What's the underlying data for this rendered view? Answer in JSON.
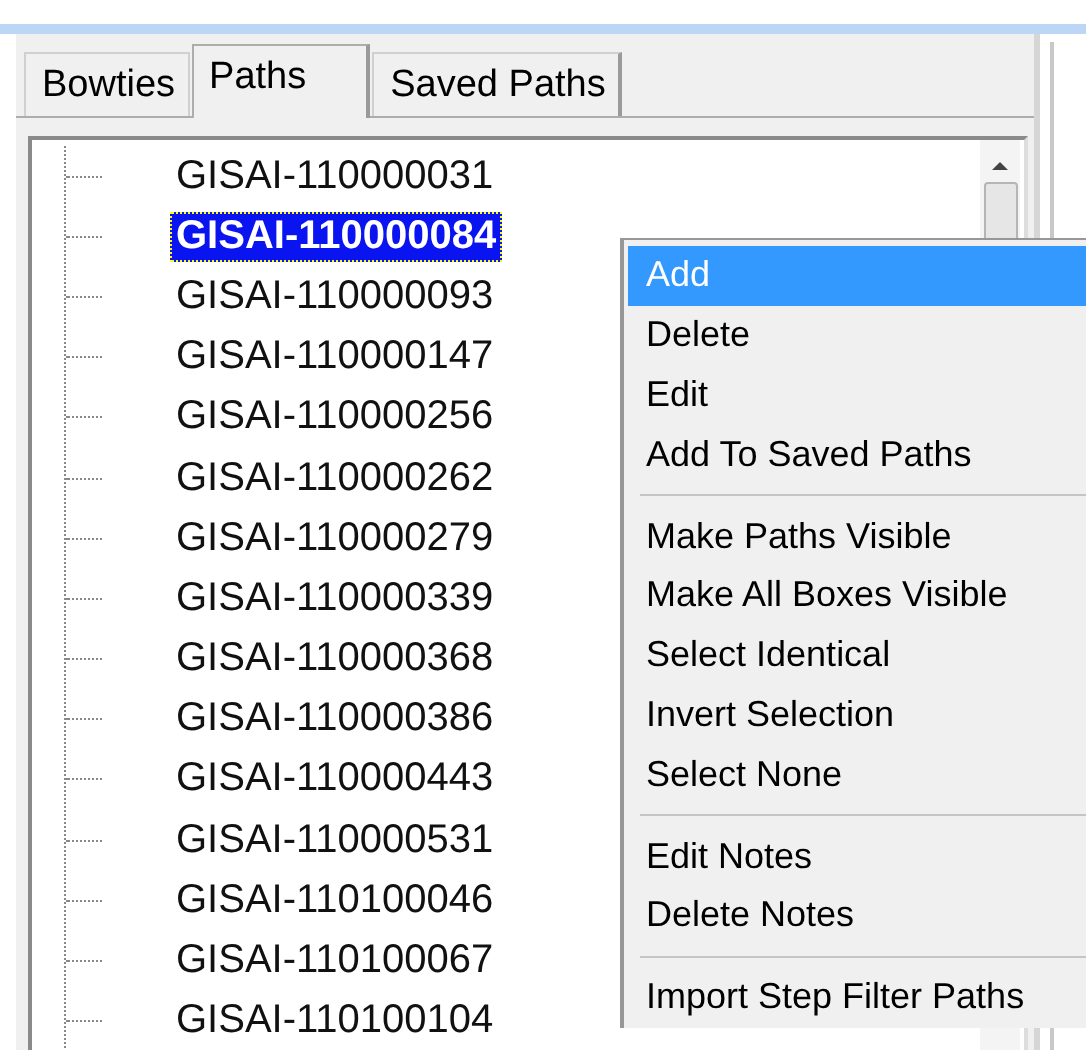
{
  "tabs": [
    {
      "label": "Bowties",
      "selected": false
    },
    {
      "label": "Paths",
      "selected": true
    },
    {
      "label": "Saved Paths",
      "selected": false
    }
  ],
  "tree": {
    "items": [
      {
        "label": "GISAI-110000031",
        "selected": false
      },
      {
        "label": "GISAI-110000084",
        "selected": true
      },
      {
        "label": "GISAI-110000093",
        "selected": false
      },
      {
        "label": "GISAI-110000147",
        "selected": false
      },
      {
        "label": "GISAI-110000256",
        "selected": false
      },
      {
        "label": "GISAI-110000262",
        "selected": false
      },
      {
        "label": "GISAI-110000279",
        "selected": false
      },
      {
        "label": "GISAI-110000339",
        "selected": false
      },
      {
        "label": "GISAI-110000368",
        "selected": false
      },
      {
        "label": "GISAI-110000386",
        "selected": false
      },
      {
        "label": "GISAI-110000443",
        "selected": false
      },
      {
        "label": "GISAI-110000531",
        "selected": false
      },
      {
        "label": "GISAI-110100046",
        "selected": false
      },
      {
        "label": "GISAI-110100067",
        "selected": false
      },
      {
        "label": "GISAI-110100104",
        "selected": false
      }
    ]
  },
  "context_menu": {
    "items": [
      {
        "kind": "item",
        "label": "Add",
        "selected": true
      },
      {
        "kind": "item",
        "label": "Delete",
        "selected": false
      },
      {
        "kind": "item",
        "label": "Edit",
        "selected": false
      },
      {
        "kind": "item",
        "label": "Add To Saved Paths",
        "selected": false
      },
      {
        "kind": "separator"
      },
      {
        "kind": "item",
        "label": "Make  Paths Visible",
        "selected": false
      },
      {
        "kind": "item",
        "label": "Make All Boxes Visible",
        "selected": false
      },
      {
        "kind": "item",
        "label": "Select Identical",
        "selected": false
      },
      {
        "kind": "item",
        "label": "Invert Selection",
        "selected": false
      },
      {
        "kind": "item",
        "label": "Select None",
        "selected": false
      },
      {
        "kind": "separator"
      },
      {
        "kind": "item",
        "label": "Edit Notes",
        "selected": false
      },
      {
        "kind": "item",
        "label": "Delete Notes",
        "selected": false
      },
      {
        "kind": "separator"
      },
      {
        "kind": "item",
        "label": "Import Step Filter Paths",
        "selected": false
      }
    ]
  }
}
